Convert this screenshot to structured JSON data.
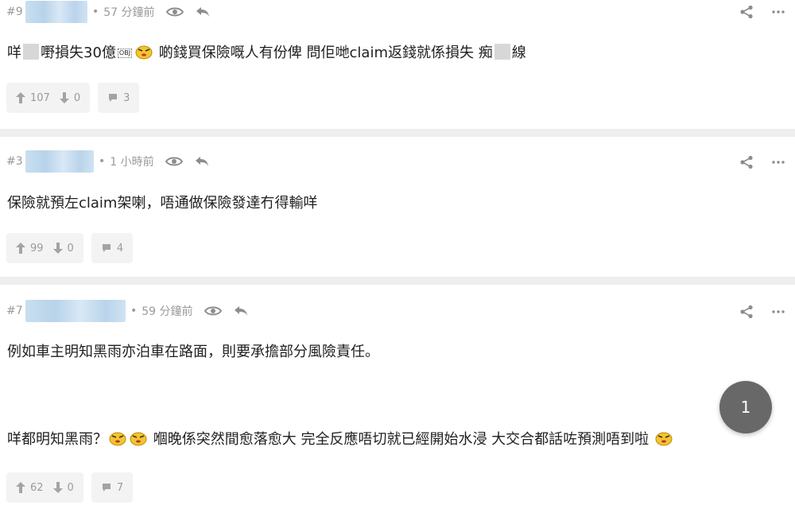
{
  "posts": [
    {
      "floor": "#9",
      "dot": "•",
      "time": "57 分鐘前",
      "content_parts": [
        "咩",
        "嘢損失30億",
        "OBJ",
        "啲錢買保險嘅人有份俾 問佢哋claim返錢就係損失 痴",
        "線"
      ],
      "upvotes": "107",
      "downvotes": "0",
      "replies": "3"
    },
    {
      "floor": "#3",
      "dot": "•",
      "time": "1 小時前",
      "content": "保險就預左claim架喇，唔通做保險發達冇得輸咩",
      "upvotes": "99",
      "downvotes": "0",
      "replies": "4"
    },
    {
      "floor": "#7",
      "dot": "•",
      "time": "59 分鐘前",
      "content_line1": "例如車主明知黑雨亦泊車在路面，則要承擔部分風險責任。",
      "content_line2a": "咩都明知黑雨？",
      "content_line2b": "嗰晚係突然間愈落愈大 完全反應唔切就已經開始水浸 大交合都話咗預測唔到啦",
      "upvotes": "62",
      "downvotes": "0",
      "replies": "7"
    }
  ],
  "fab_label": "1",
  "icons": {
    "view": "eye-icon",
    "reply": "reply-icon",
    "share": "share-icon",
    "more": "more-icon",
    "up": "thumb-up-arrow-icon",
    "down": "thumb-down-arrow-icon",
    "comment": "comment-icon",
    "emoji": "angry-face-emoji"
  },
  "colors": {
    "meta_gray": "#9a9a9a",
    "divider": "#eeeeee",
    "fab": "#686868"
  }
}
